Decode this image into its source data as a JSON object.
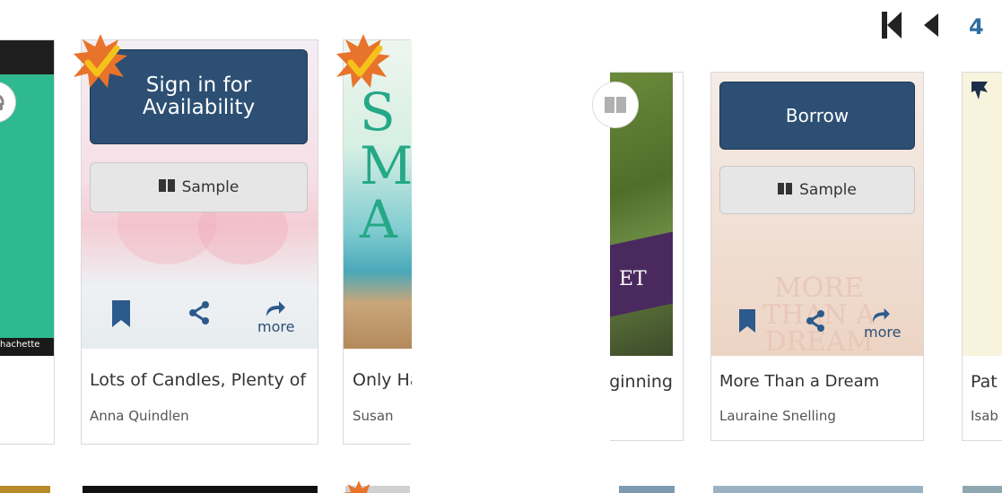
{
  "pagination": {
    "current_page": "4"
  },
  "cards": [
    {
      "title": "Lots of Candles, Plenty of Cake",
      "author": "Anna Quindlen",
      "primary_action": "Sign in for Availability",
      "sample_label": "Sample",
      "more_label": "more"
    },
    {
      "title": "Only Happy Here",
      "author": "Susan",
      "cover_text": "S MA"
    },
    {
      "title": "Beginning",
      "cover_text": "ET"
    },
    {
      "title": "More Than a Dream",
      "author": "Lauraine Snelling",
      "primary_action": "Borrow",
      "sample_label": "Sample",
      "more_label": "more",
      "cover_text": "MORE THAN A DREAM"
    },
    {
      "title": "Pat",
      "author": "Isab"
    }
  ],
  "left_partial": {
    "publisher": "hachette"
  },
  "colors": {
    "accent": "#2c4f73",
    "badge_orange": "#e8732b"
  }
}
